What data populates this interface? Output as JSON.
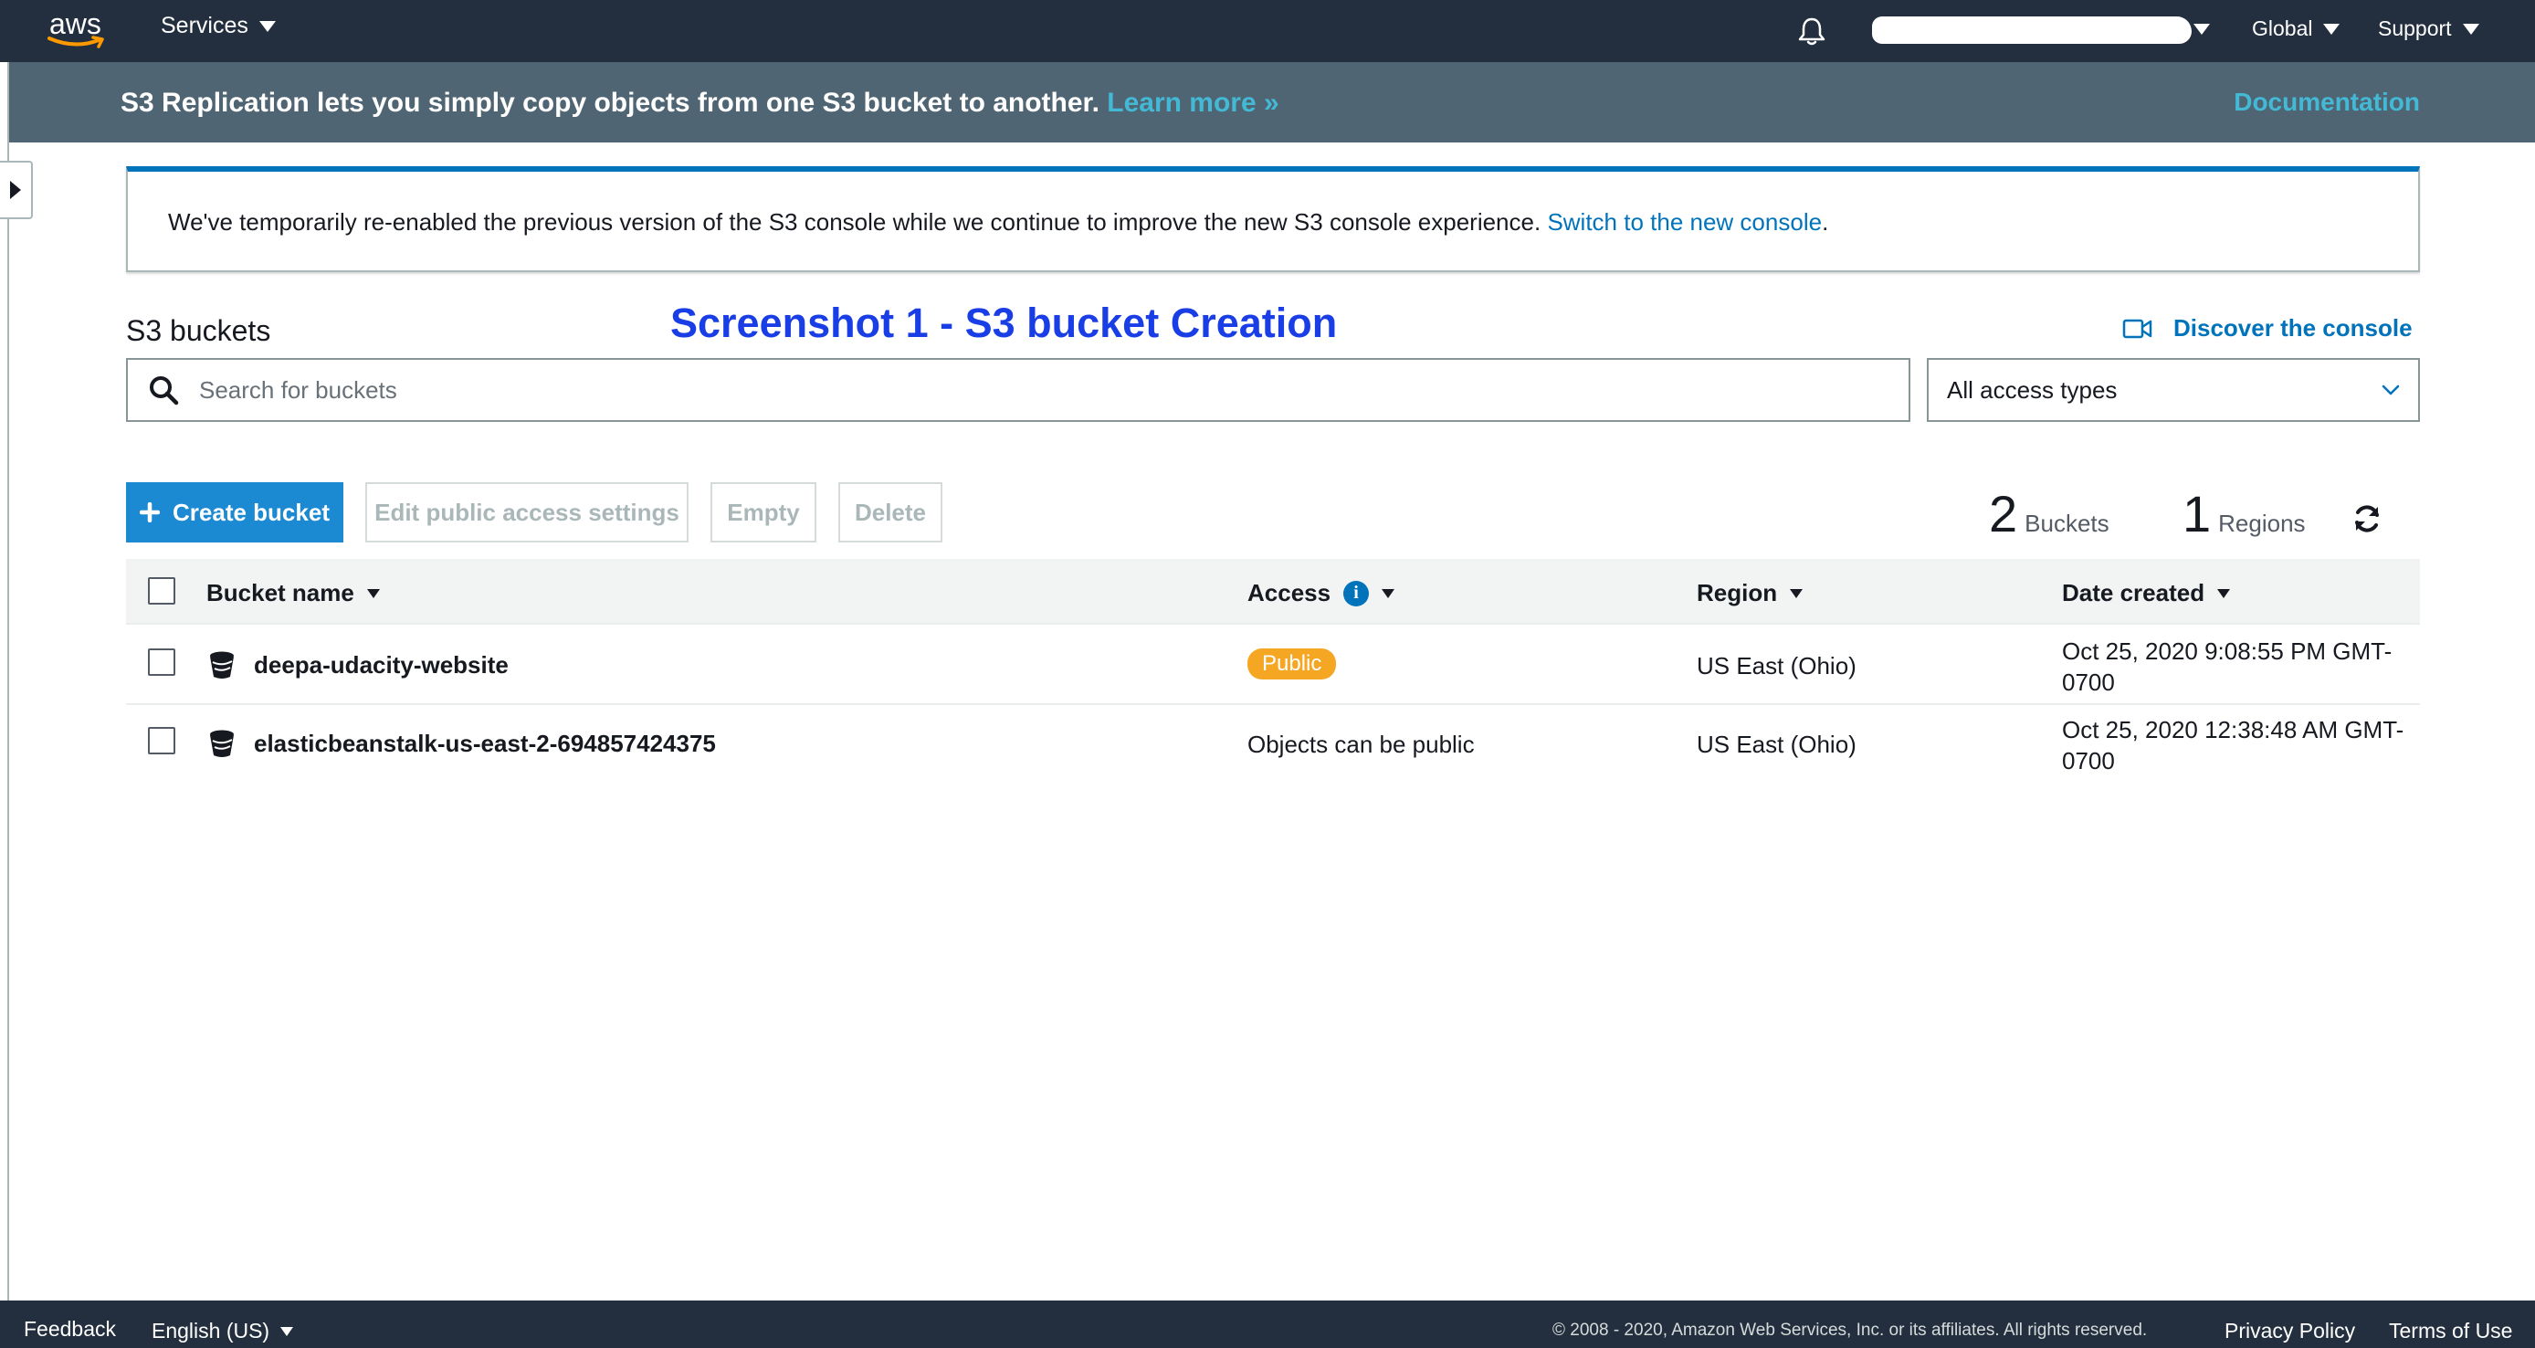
{
  "topnav": {
    "logo_text": "aws",
    "services_label": "Services",
    "region_label": "Global",
    "support_label": "Support",
    "icons": {
      "notifications": "bell-icon"
    }
  },
  "banner": {
    "text": "S3 Replication lets you simply copy objects from one S3 bucket to another.",
    "learn_more": "Learn more »",
    "documentation": "Documentation"
  },
  "notice": {
    "text": "We've temporarily re-enabled the previous version of the S3 console while we continue to improve the new S3 console experience.",
    "link": "Switch to the new console",
    "trailing": "."
  },
  "page": {
    "title": "S3 buckets",
    "annotation": "Screenshot 1 - S3 bucket Creation",
    "discover": "Discover the console"
  },
  "search": {
    "placeholder": "Search for buckets",
    "value": ""
  },
  "filter": {
    "selected": "All access types"
  },
  "actions": {
    "create": "Create bucket",
    "edit_public": "Edit public access settings",
    "empty": "Empty",
    "delete": "Delete"
  },
  "counts": {
    "buckets_num": "2",
    "buckets_label": "Buckets",
    "regions_num": "1",
    "regions_label": "Regions"
  },
  "table": {
    "headers": {
      "name": "Bucket name",
      "access": "Access",
      "region": "Region",
      "date": "Date created"
    },
    "rows": [
      {
        "name": "deepa-udacity-website",
        "access": "Public",
        "region": "US East (Ohio)",
        "date_line1": "Oct 25, 2020 9:08:55 PM GMT-",
        "date_line2": "0700"
      },
      {
        "name": "elasticbeanstalk-us-east-2-694857424375",
        "access": "Objects can be public",
        "region": "US East (Ohio)",
        "date_line1": "Oct 25, 2020 12:38:48 AM GMT-",
        "date_line2": "0700"
      }
    ]
  },
  "footer": {
    "feedback": "Feedback",
    "language": "English (US)",
    "copyright": "© 2008 - 2020, Amazon Web Services, Inc. or its affiliates. All rights reserved.",
    "privacy": "Privacy Policy",
    "terms": "Terms of Use"
  },
  "colors": {
    "nav_bg": "#232f3e",
    "banner_bg": "#4f6573",
    "link": "#0073bb",
    "primary_button": "#1b8ad3",
    "public_badge": "#f5a623",
    "annotation": "#1a3ee6"
  }
}
